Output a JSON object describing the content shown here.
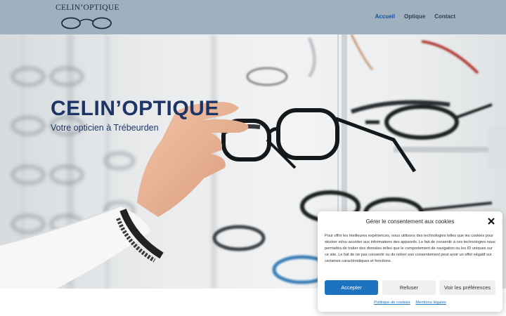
{
  "header": {
    "logo_text": "CELIN’OPTIQUE",
    "nav": [
      {
        "label": "Accueil",
        "active": true
      },
      {
        "label": "Optique",
        "active": false
      },
      {
        "label": "Contact",
        "active": false
      }
    ],
    "accent_color": "#1a4fa0"
  },
  "hero": {
    "title": "CELIN’OPTIQUE",
    "subtitle": "Votre opticien à Trébeurden"
  },
  "cookie": {
    "title": "Gérer le consentement aux cookies",
    "body": "Pour offrir les meilleures expériences, nous utilisons des technologies telles que les cookies pour stocker et/ou accéder aux informations des appareils. Le fait de consentir à ces technologies nous permettra de traiter des données telles que le comportement de navigation ou les ID uniques sur ce site. Le fait de ne pas consentir ou de retirer son consentement peut avoir un effet négatif sur certaines caractéristiques et fonctions.",
    "accept_label": "Accepter",
    "refuse_label": "Refuser",
    "prefs_label": "Voir les préférences",
    "cookie_policy_label": "Politique de cookies",
    "legal_label": "Mentions légales",
    "accept_color": "#1e73be"
  }
}
